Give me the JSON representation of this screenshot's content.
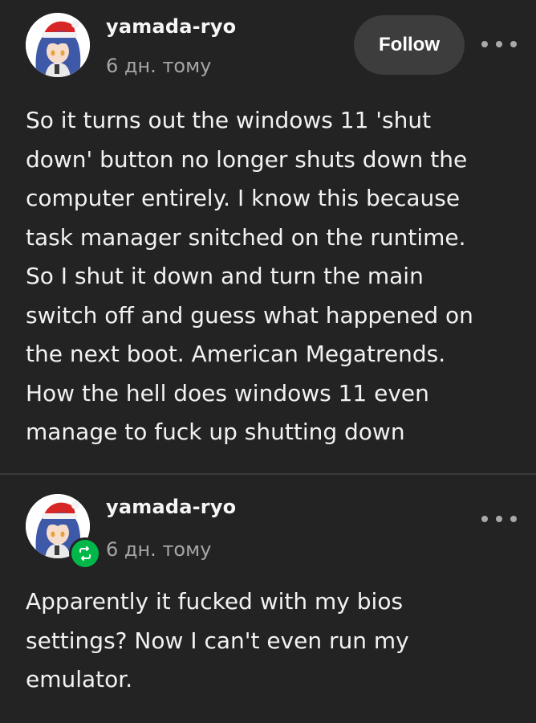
{
  "posts": [
    {
      "username": "yamada-ryo",
      "timestamp": "6 дн. тому",
      "follow_label": "Follow",
      "body_lines": [
        "So it turns out the windows 11 'shut",
        "down' button no longer shuts down the",
        "computer entirely. I know this because",
        "task manager snitched on the runtime.",
        "So I shut it down and turn the main",
        "switch off and guess what happened on",
        "the next boot. American Megatrends.",
        "How the hell does windows 11 even",
        "manage to fuck up shutting down"
      ]
    },
    {
      "username": "yamada-ryo",
      "timestamp": "6 дн. тому",
      "badge_icon": "reblog-icon",
      "body_lines": [
        "Apparently it fucked with my bios",
        "settings? Now I can't even run my",
        "emulator."
      ]
    }
  ],
  "colors": {
    "background": "#232323",
    "follow_button": "#3d3d3d",
    "reblog_badge": "#00b84a",
    "secondary_text": "#a6a6a6"
  }
}
